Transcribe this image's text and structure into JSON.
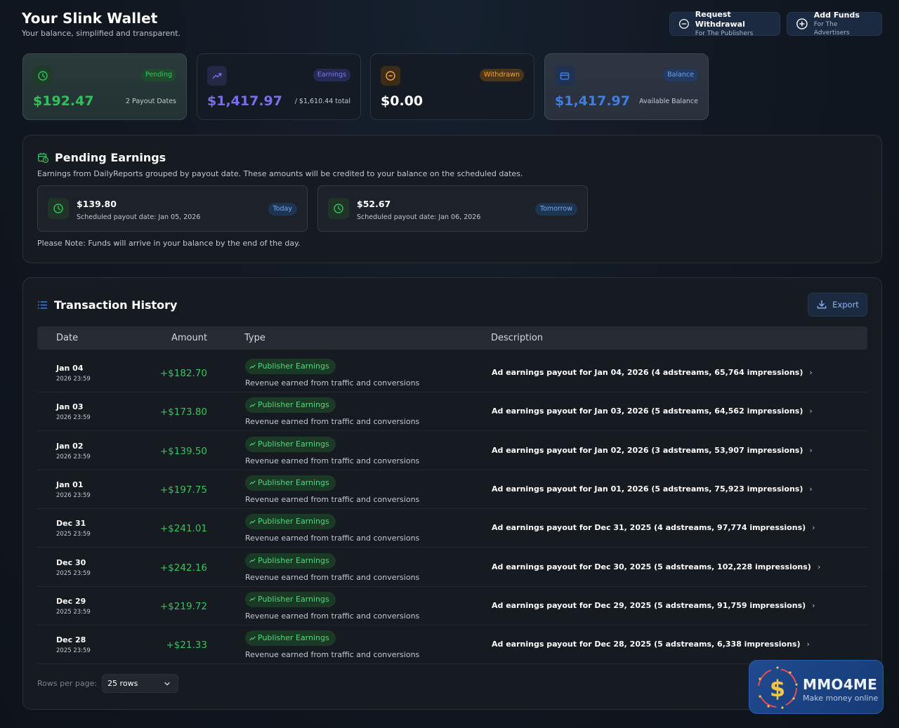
{
  "header": {
    "title": "Your Slink Wallet",
    "subtitle": "Your balance, simplified and transparent.",
    "withdraw_btn": {
      "label": "Request Withdrawal",
      "sub": "For The Publishers",
      "icon": "minus-circle-icon"
    },
    "add_funds_btn": {
      "label": "Add Funds",
      "sub": "For The Advertisers",
      "icon": "plus-circle-icon"
    }
  },
  "stats": {
    "pending": {
      "badge": "Pending",
      "amount": "$192.47",
      "caption": "2 Payout Dates",
      "color": "#2fc15a",
      "icon": "clock-icon"
    },
    "earnings": {
      "badge": "Earnings",
      "amount": "$1,417.97",
      "caption": "/ $1,610.44 total",
      "color": "#7a6fe8",
      "icon": "trending-up-icon"
    },
    "withdrawn": {
      "badge": "Withdrawn",
      "amount": "$0.00",
      "caption": "",
      "color": "#f0a33a",
      "icon": "minus-circle-icon"
    },
    "balance": {
      "badge": "Balance",
      "amount": "$1,417.97",
      "caption": "Available Balance",
      "color": "#3f7ee0",
      "icon": "wallet-icon"
    }
  },
  "pending_earnings": {
    "title": "Pending Earnings",
    "description": "Earnings from DailyReports grouped by payout date. These amounts will be credited to your balance on the scheduled dates.",
    "payouts": [
      {
        "amount": "$139.80",
        "date": "Scheduled payout date: Jan 05, 2026",
        "tag": "Today"
      },
      {
        "amount": "$52.67",
        "date": "Scheduled payout date: Jan 06, 2026",
        "tag": "Tomorrow"
      }
    ],
    "note": "Please Note: Funds will arrive in your balance by the end of the day."
  },
  "transactions": {
    "title": "Transaction History",
    "export_label": "Export",
    "columns": [
      "Date",
      "Amount",
      "Type",
      "Description"
    ],
    "rows": [
      {
        "date": "Jan 04",
        "time": "2026 23:59",
        "amount": "+$182.70",
        "type": "Publisher Earnings",
        "type_desc": "Revenue earned from traffic and conversions",
        "description": "Ad earnings payout for Jan 04, 2026 (4 adstreams, 65,764 impressions)"
      },
      {
        "date": "Jan 03",
        "time": "2026 23:59",
        "amount": "+$173.80",
        "type": "Publisher Earnings",
        "type_desc": "Revenue earned from traffic and conversions",
        "description": "Ad earnings payout for Jan 03, 2026 (5 adstreams, 64,562 impressions)"
      },
      {
        "date": "Jan 02",
        "time": "2026 23:59",
        "amount": "+$139.50",
        "type": "Publisher Earnings",
        "type_desc": "Revenue earned from traffic and conversions",
        "description": "Ad earnings payout for Jan 02, 2026 (3 adstreams, 53,907 impressions)"
      },
      {
        "date": "Jan 01",
        "time": "2026 23:59",
        "amount": "+$197.75",
        "type": "Publisher Earnings",
        "type_desc": "Revenue earned from traffic and conversions",
        "description": "Ad earnings payout for Jan 01, 2026 (5 adstreams, 75,923 impressions)"
      },
      {
        "date": "Dec 31",
        "time": "2025 23:59",
        "amount": "+$241.01",
        "type": "Publisher Earnings",
        "type_desc": "Revenue earned from traffic and conversions",
        "description": "Ad earnings payout for Dec 31, 2025 (4 adstreams, 97,774 impressions)"
      },
      {
        "date": "Dec 30",
        "time": "2025 23:59",
        "amount": "+$242.16",
        "type": "Publisher Earnings",
        "type_desc": "Revenue earned from traffic and conversions",
        "description": "Ad earnings payout for Dec 30, 2025 (5 adstreams, 102,228 impressions)"
      },
      {
        "date": "Dec 29",
        "time": "2025 23:59",
        "amount": "+$219.72",
        "type": "Publisher Earnings",
        "type_desc": "Revenue earned from traffic and conversions",
        "description": "Ad earnings payout for Dec 29, 2025 (5 adstreams, 91,759 impressions)"
      },
      {
        "date": "Dec 28",
        "time": "2025 23:59",
        "amount": "+$21.33",
        "type": "Publisher Earnings",
        "type_desc": "Revenue earned from traffic and conversions",
        "description": "Ad earnings payout for Dec 28, 2025 (5 adstreams, 6,338 impressions)"
      }
    ],
    "rows_per_page_label": "Rows per page:",
    "rows_per_page_value": "25 rows"
  },
  "watermark": {
    "brand": "MMO4ME",
    "slogan": "Make money online"
  }
}
